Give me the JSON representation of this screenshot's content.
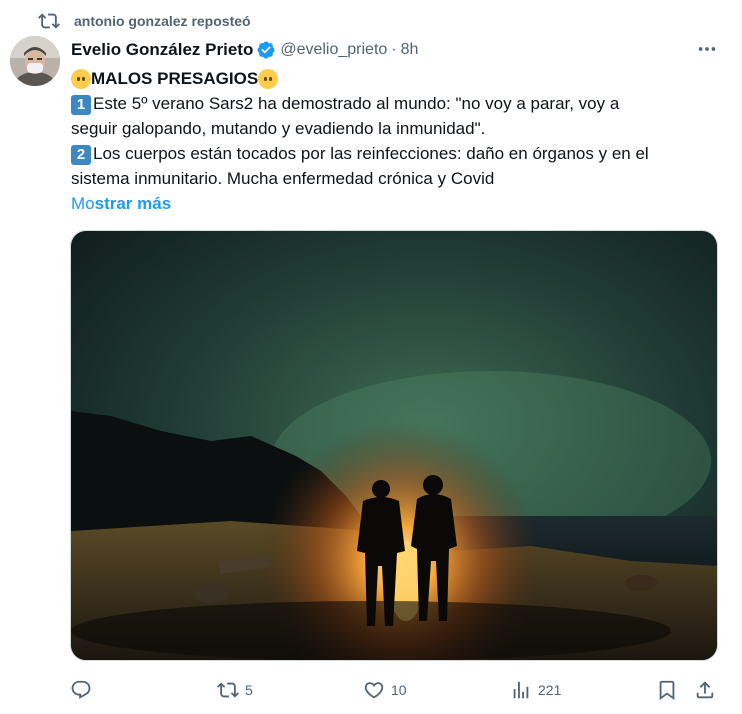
{
  "repost": {
    "text": "antonio gonzalez reposteó",
    "icon": "repost-icon"
  },
  "author": {
    "display_name": "Evelio González Prieto",
    "handle": "@evelio_prieto",
    "dot": "·",
    "time": "8h",
    "verified": true
  },
  "tweet": {
    "title": "MALOS PRESAGIOS",
    "p1_num": "1",
    "p1_line1": "Este 5º verano Sars2 ha demostrado al mundo: \"no voy a parar, voy a",
    "p1_line2": "seguir galopando, mutando y evadiendo la inmunidad\".",
    "p2_num": "2",
    "p2_line1": "Los cuerpos están tocados por las reinfecciones: daño en órganos y en el",
    "p2_line2": "sistema inmunitario. Mucha enfermedad crónica y Covid",
    "show_more_a": "Mo",
    "show_more_b": "strar más"
  },
  "media": {
    "description": "night-bonfire-aurora-photo"
  },
  "actions": {
    "reply": {
      "icon": "reply-icon",
      "count": ""
    },
    "repost": {
      "icon": "repost-icon",
      "count": "5"
    },
    "like": {
      "icon": "heart-icon",
      "count": "10"
    },
    "views": {
      "icon": "views-icon",
      "count": "221"
    },
    "bookmark": {
      "icon": "bookmark-icon"
    },
    "share": {
      "icon": "share-icon"
    }
  },
  "colors": {
    "accent": "#1d9bf0",
    "secondary_text": "#536471",
    "repost_green": "#536471",
    "verified_blue": "#1d9bf0"
  }
}
